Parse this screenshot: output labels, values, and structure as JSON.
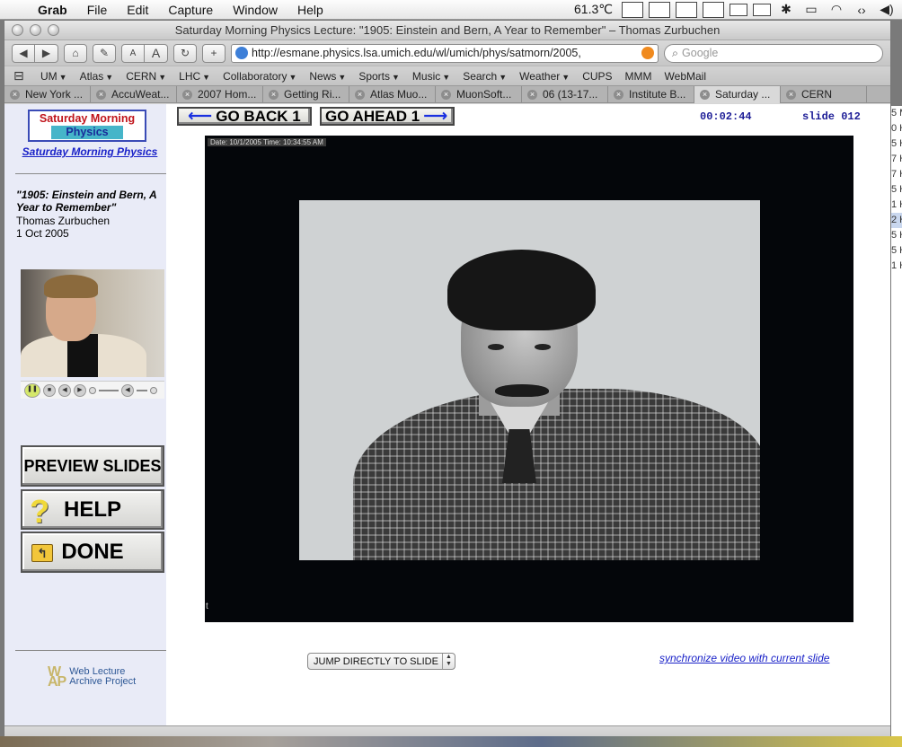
{
  "menubar": {
    "app_name": "Grab",
    "items": [
      "File",
      "Edit",
      "Capture",
      "Window",
      "Help"
    ],
    "temperature": "61.3℃"
  },
  "window": {
    "title": "Saturday Morning Physics Lecture: \"1905: Einstein and Bern, A Year to Remember\" – Thomas Zurbuchen"
  },
  "toolbar": {
    "url": "http://esmane.physics.lsa.umich.edu/wl/umich/phys/satmorn/2005,",
    "search_placeholder": "Google",
    "font_small": "A",
    "font_large": "A",
    "add_label": "+"
  },
  "bookmarks": [
    {
      "label": "UM",
      "menu": true
    },
    {
      "label": "Atlas",
      "menu": true
    },
    {
      "label": "CERN",
      "menu": true
    },
    {
      "label": "LHC",
      "menu": true
    },
    {
      "label": "Collaboratory",
      "menu": true
    },
    {
      "label": "News",
      "menu": true
    },
    {
      "label": "Sports",
      "menu": true
    },
    {
      "label": "Music",
      "menu": true
    },
    {
      "label": "Search",
      "menu": true
    },
    {
      "label": "Weather",
      "menu": true
    },
    {
      "label": "CUPS",
      "menu": false
    },
    {
      "label": "MMM",
      "menu": false
    },
    {
      "label": "WebMail",
      "menu": false
    }
  ],
  "tabs": [
    {
      "label": "New York ...",
      "active": false
    },
    {
      "label": "AccuWeat...",
      "active": false
    },
    {
      "label": "2007 Hom...",
      "active": false
    },
    {
      "label": "Getting Ri...",
      "active": false
    },
    {
      "label": "Atlas Muo...",
      "active": false
    },
    {
      "label": "MuonSoft...",
      "active": false
    },
    {
      "label": "06 (13-17...",
      "active": false
    },
    {
      "label": "Institute B...",
      "active": false
    },
    {
      "label": "Saturday ...",
      "active": true
    },
    {
      "label": "CERN",
      "active": false
    }
  ],
  "sidebar": {
    "logo_line1": "Saturday Morning",
    "logo_line2": "Physics",
    "logo_link": "Saturday Morning Physics",
    "lecture_title": "\"1905: Einstein and Bern, A Year to Remember\"",
    "lecturer": "Thomas Zurbuchen",
    "date": "1 Oct 2005",
    "preview_label": "PREVIEW SLIDES",
    "help_label": "HELP",
    "done_label": "DONE",
    "wlap_line1": "Web Lecture",
    "wlap_line2": "Archive Project"
  },
  "navigation": {
    "back_label": "GO BACK 1",
    "ahead_label": "GO AHEAD 1",
    "timer": "00:02:44",
    "slide_number": "slide 012"
  },
  "slide": {
    "stamp": "Date: 10/1/2005 Time: 10:34:55 AM",
    "corner_mark": "t"
  },
  "controls": {
    "jump_label": "JUMP DIRECTLY TO SLIDE",
    "sync_link": "synchronize video with current slide"
  },
  "background_window": {
    "lines": [
      "5 M",
      "0 H",
      "5 H",
      "7 H",
      "7 H",
      "5 H",
      "1 H",
      "2 H",
      "5 H",
      "5 H",
      "1 H"
    ]
  }
}
